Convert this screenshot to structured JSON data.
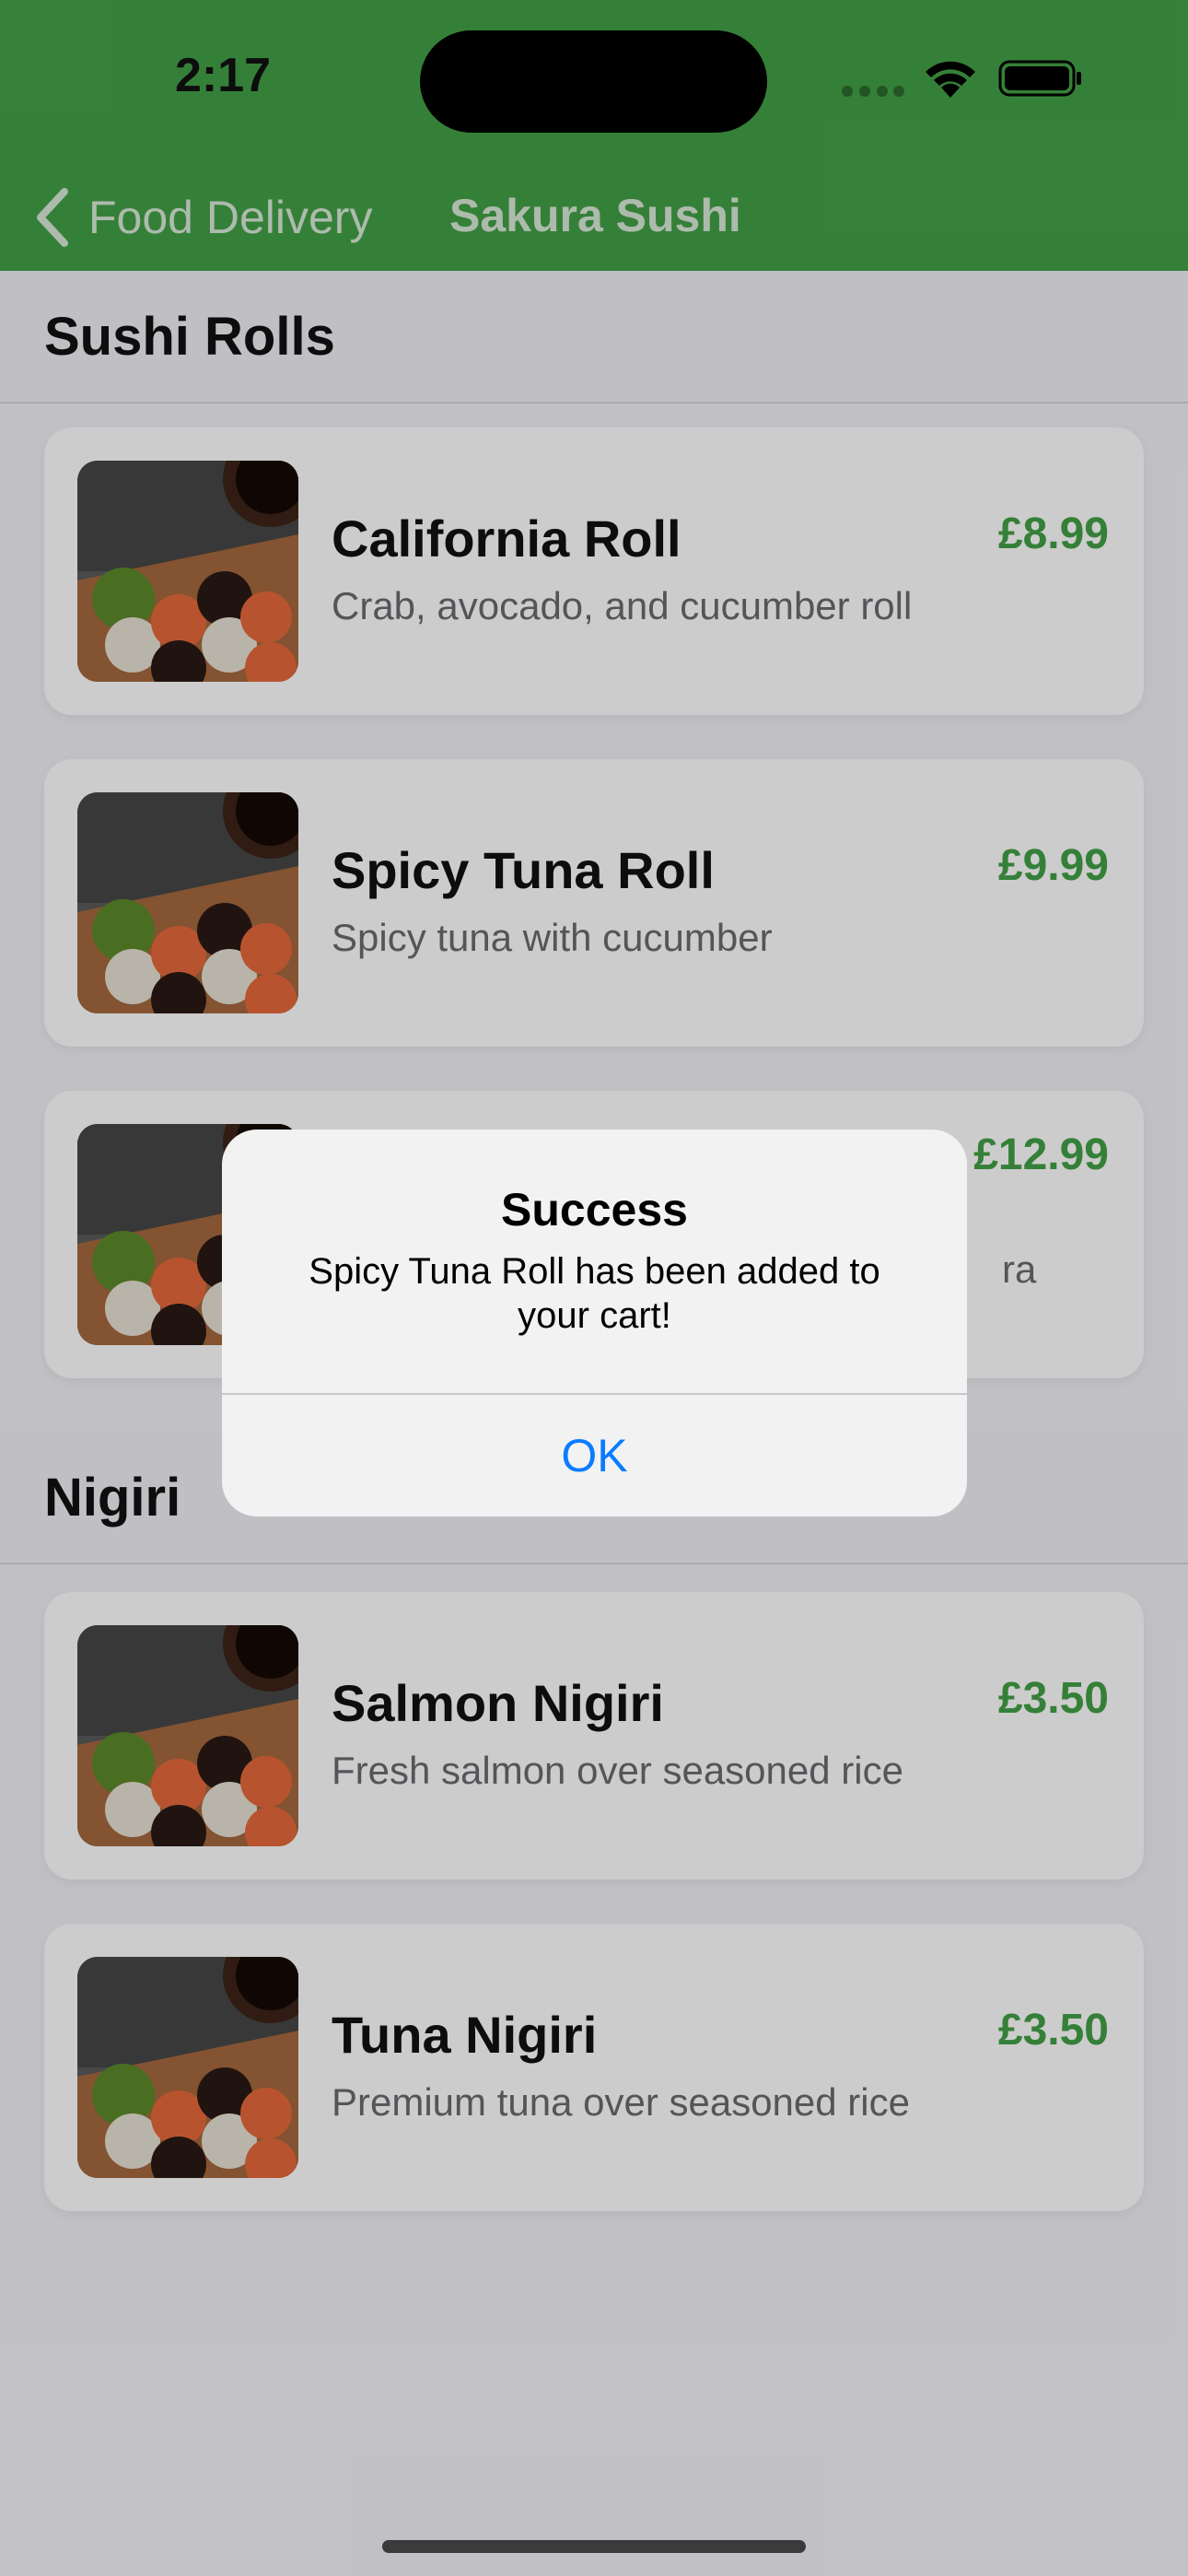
{
  "status_bar": {
    "time": "2:17"
  },
  "nav": {
    "back_label": "Food Delivery",
    "title": "Sakura Sushi"
  },
  "sections": [
    {
      "title": "Sushi Rolls",
      "items": [
        {
          "name": "California Roll",
          "description": "Crab, avocado, and cucumber roll",
          "price": "£8.99"
        },
        {
          "name": "Spicy Tuna Roll",
          "description": "Spicy tuna with cucumber",
          "price": "£9.99"
        },
        {
          "name": "",
          "description": "ra",
          "price": "£12.99"
        }
      ]
    },
    {
      "title": "Nigiri",
      "items": [
        {
          "name": "Salmon Nigiri",
          "description": "Fresh salmon over seasoned rice",
          "price": "£3.50"
        },
        {
          "name": "Tuna Nigiri",
          "description": "Premium tuna over seasoned rice",
          "price": "£3.50"
        }
      ]
    }
  ],
  "alert": {
    "title": "Success",
    "message": "Spicy Tuna Roll has been added to your cart!",
    "ok_label": "OK"
  },
  "colors": {
    "header_green": "#43a047",
    "price_green": "#43a047",
    "alert_button_blue": "#0a7cff"
  }
}
